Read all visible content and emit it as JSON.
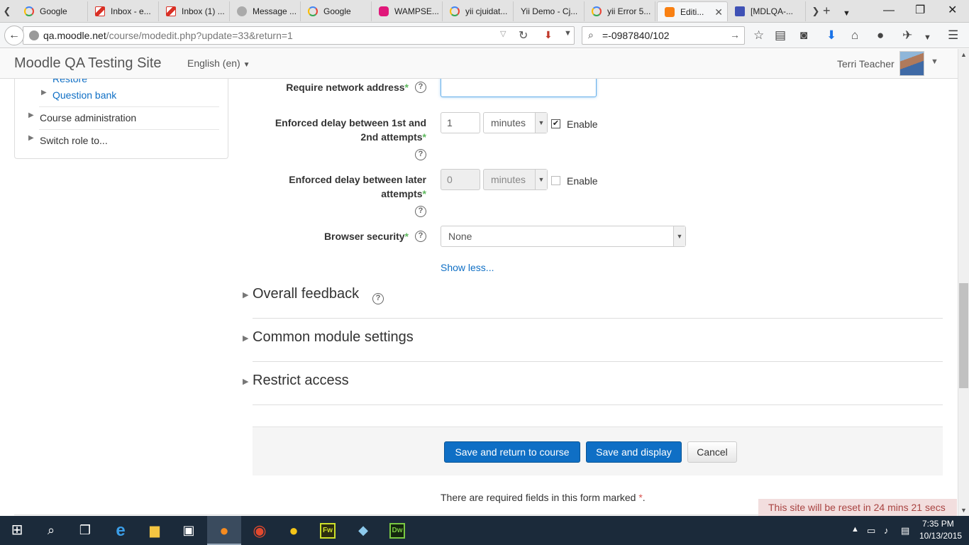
{
  "browser": {
    "tabs": [
      {
        "title": "Google",
        "favicon": "google-favicon"
      },
      {
        "title": "Inbox - e...",
        "favicon": "gmail-favicon"
      },
      {
        "title": "Inbox (1) ...",
        "favicon": "gmail-favicon"
      },
      {
        "title": "Message ...",
        "favicon": "yahoo-favicon"
      },
      {
        "title": "Google",
        "favicon": "google-favicon"
      },
      {
        "title": "WAMPSE...",
        "favicon": "wamp-favicon"
      },
      {
        "title": "yii cjuidat...",
        "favicon": "google-favicon"
      },
      {
        "title": "Yii Demo - Cj...",
        "favicon": "none"
      },
      {
        "title": "yii Error 5...",
        "favicon": "google-favicon"
      },
      {
        "title": "Editi...",
        "favicon": "moodle-favicon",
        "active": true
      },
      {
        "title": "[MDLQA-...",
        "favicon": "jira-favicon"
      }
    ],
    "url_host": "qa.moodle.net",
    "url_path": "/course/modedit.php?update=33&return=1",
    "search_value": "=-0987840/102"
  },
  "header": {
    "site_title": "Moodle QA Testing Site",
    "language": "English (en)",
    "user_name": "Terri Teacher"
  },
  "sidebar": {
    "items": [
      {
        "label": "Restore"
      },
      {
        "label": "Question bank"
      },
      {
        "label": "Course administration"
      },
      {
        "label": "Switch role to..."
      }
    ]
  },
  "form": {
    "require_network": {
      "label": "Require network address",
      "value": ""
    },
    "delay_first": {
      "label_line1": "Enforced delay between 1st and",
      "label_line2": "2nd attempts",
      "value": "1",
      "unit": "minutes",
      "enable_label": "Enable",
      "enabled": true
    },
    "delay_later": {
      "label_line1": "Enforced delay between later",
      "label_line2": "attempts",
      "value": "0",
      "unit": "minutes",
      "enable_label": "Enable",
      "enabled": false
    },
    "browser_security": {
      "label": "Browser security",
      "value": "None"
    },
    "show_less": "Show less...",
    "required_marker": "*",
    "help_glyph": "?"
  },
  "sections": [
    {
      "title": "Overall feedback",
      "has_help": true
    },
    {
      "title": "Common module settings",
      "has_help": false
    },
    {
      "title": "Restrict access",
      "has_help": false
    }
  ],
  "buttons": {
    "save_return": "Save and return to course",
    "save_display": "Save and display",
    "cancel": "Cancel"
  },
  "required_note": "There are required fields in this form marked",
  "reset_notice": "This site will be reset in 24 mins 21 secs",
  "taskbar": {
    "time": "7:35 PM",
    "date": "10/13/2015",
    "apps": [
      "start-icon",
      "search-icon",
      "task-view-icon",
      "edge-icon",
      "file-explorer-icon",
      "store-icon",
      "firefox-icon",
      "chrome-icon",
      "app-icon",
      "fireworks-icon",
      "app-icon",
      "dreamweaver-icon"
    ]
  },
  "colors": {
    "link": "#0f6fc5",
    "primary_button": "#0f6fc5",
    "required": "#5cb85c",
    "notice_bg": "#f2dede",
    "notice_text": "#a94442"
  }
}
